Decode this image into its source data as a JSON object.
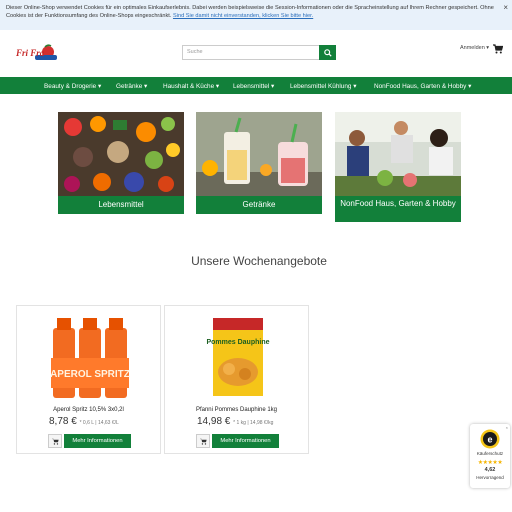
{
  "cookie": {
    "text": "Dieser Online-Shop verwendet Cookies für ein optimales Einkaufserlebnis. Dabei werden beispielsweise die Session-Informationen oder die Spracheinstellung auf Ihrem Rechner gespeichert. Ohne Cookies ist der Funktionsumfang des Online-Shops eingeschränkt.",
    "link": "Sind Sie damit nicht einverstanden, klicken Sie bitte hier.",
    "close": "×"
  },
  "header": {
    "logo_text": "Fri Fra",
    "search_placeholder": "Suche",
    "login_label": "Anmelden ▾"
  },
  "nav": {
    "items": [
      {
        "label": "Beauty & Drogerie ▾"
      },
      {
        "label": "Getränke ▾"
      },
      {
        "label": "Haushalt & Küche ▾"
      },
      {
        "label": "Lebensmittel ▾"
      },
      {
        "label": "Lebensmittel Kühlung ▾"
      },
      {
        "label": "NonFood Haus, Garten & Hobby ▾"
      }
    ]
  },
  "categories": [
    {
      "label": "Lebensmittel"
    },
    {
      "label": "Getränke"
    },
    {
      "label": "NonFood Haus, Garten & Hobby"
    }
  ],
  "offers": {
    "title": "Unsere Wochenangebote",
    "products": [
      {
        "name": "Aperol Spritz 10,5% 3x0,2l",
        "price": "8,78 €",
        "unit": "* 0,6 L | 14,63 €/L",
        "button": "Mehr Informationen",
        "label_text": "APEROL SPRITZ"
      },
      {
        "name": "Pfanni Pommes Dauphine 1kg",
        "price": "14,98 €",
        "unit": "* 1 kg | 14,98 €/kg",
        "button": "Mehr Informationen",
        "label_text": "Pommes Dauphine"
      }
    ]
  },
  "trust": {
    "title": "Käuferschutz",
    "stars": "★★★★★",
    "score": "4,62",
    "rating": "Hervorragend",
    "close": "×"
  },
  "colors": {
    "brand_green": "#12803a",
    "cookie_bg": "#e8f1fa",
    "link_blue": "#2a6ebb"
  }
}
